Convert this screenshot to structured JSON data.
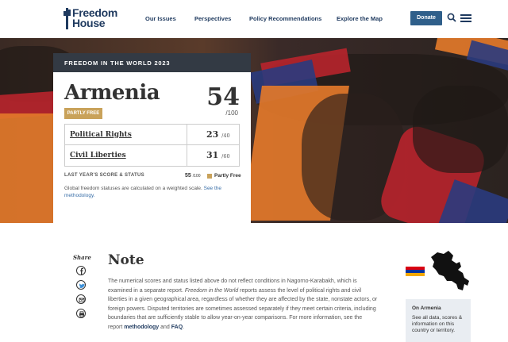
{
  "header": {
    "logo_line1": "Freedom",
    "logo_line2": "House",
    "nav": [
      "Our Issues",
      "Perspectives",
      "Policy Recommendations",
      "Explore the Map"
    ],
    "donate_label": "Donate",
    "icons": [
      "search-icon",
      "hamburger-menu-icon"
    ]
  },
  "card": {
    "band_title": "FREEDOM IN THE WORLD 2023",
    "country": "Armenia",
    "status": "PARTLY FREE",
    "score": "54",
    "score_of": "/100",
    "rows": [
      {
        "label": "Political Rights",
        "value": "23",
        "max": "/40"
      },
      {
        "label": "Civil Liberties",
        "value": "31",
        "max": "/60"
      }
    ],
    "last_year_label": "LAST YEAR'S SCORE & STATUS",
    "last_year_score": "55",
    "last_year_max": "/100",
    "last_year_status": "Partly Free",
    "footnote_text": "Global freedom statuses are calculated on a weighted scale. ",
    "footnote_link": "See the methodology.",
    "colors": {
      "band": "#333a44",
      "status": "#c9a25a"
    }
  },
  "share": {
    "label": "Share",
    "icons": [
      "facebook-icon",
      "twitter-icon",
      "email-icon",
      "print-icon"
    ]
  },
  "note": {
    "title": "Note",
    "body_1": "The numerical scores and status listed above do not reflect conditions in Nagorno-Karabakh, which is examined in a separate report. ",
    "body_em": "Freedom in the World",
    "body_2": " reports assess the level of political rights and civil liberties in a given geographical area, regardless of whether they are affected by the state, nonstate actors, or foreign powers. Disputed territories are sometimes assessed separately if they meet certain criteria, including boundaries that are sufficiently stable to allow year-on-year comparisons. For more information, see the report ",
    "link_methodology": "methodology",
    "and": " and ",
    "link_faq": "FAQ",
    "end": "."
  },
  "sidebar": {
    "on_title": "On Armenia",
    "on_desc": "See all data, scores & information on this country or territory.",
    "flag_colors": [
      "#d90012",
      "#0033a0",
      "#f2a800"
    ]
  }
}
